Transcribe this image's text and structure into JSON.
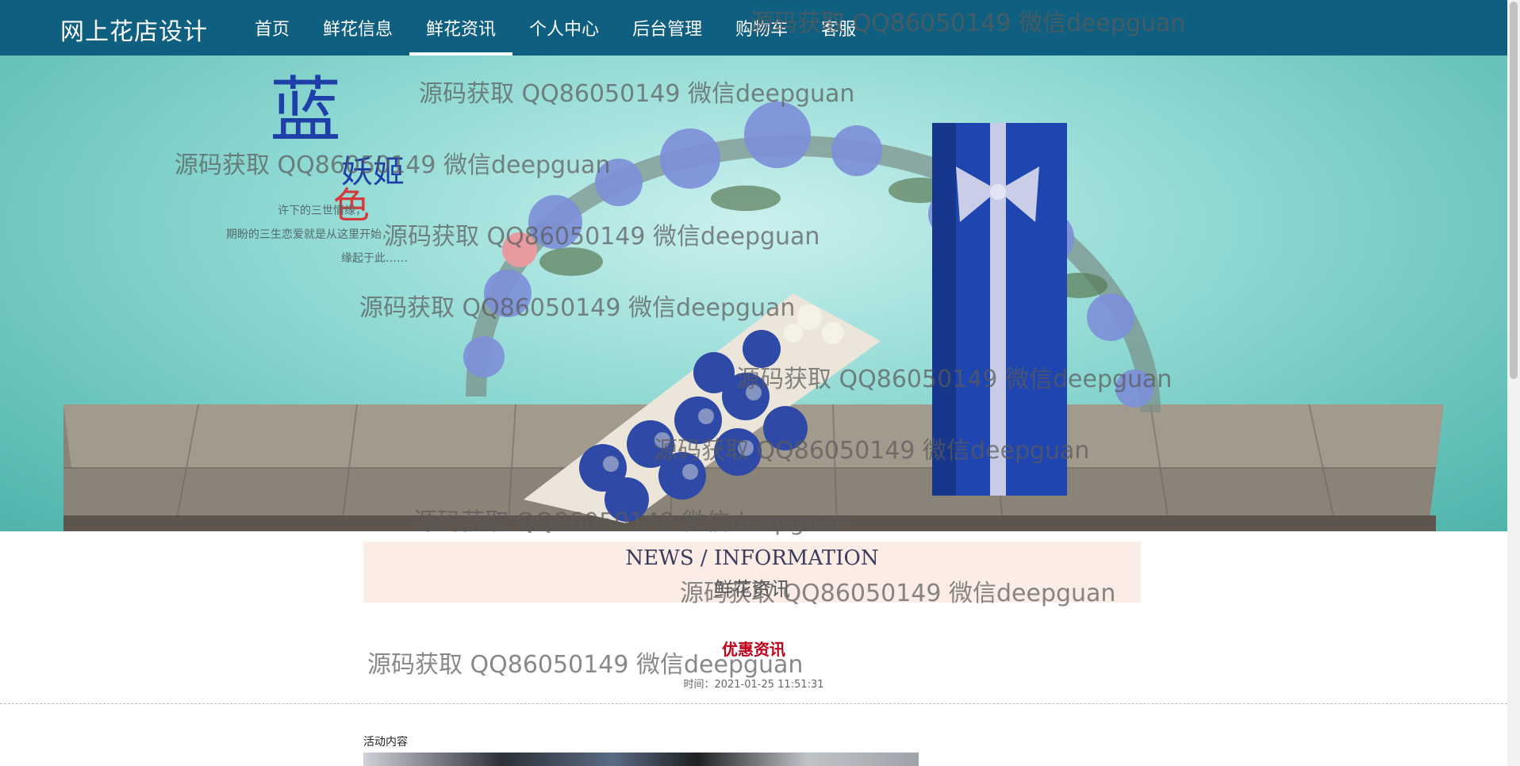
{
  "brand": "网上花店设计",
  "nav": {
    "items": [
      {
        "label": "首页"
      },
      {
        "label": "鲜花信息"
      },
      {
        "label": "鲜花资讯",
        "active": true
      },
      {
        "label": "个人中心"
      },
      {
        "label": "后台管理"
      },
      {
        "label": "购物车"
      },
      {
        "label": "客服"
      }
    ]
  },
  "banner": {
    "calligraphy_title": "蓝色妖姬",
    "poem_lines": [
      "许下的三世情缘，",
      "期盼的三生恋爱就是从这里开始，",
      "缘起于此……"
    ]
  },
  "section": {
    "title_en": "NEWS / INFORMATION",
    "title_zh": "鲜花资讯"
  },
  "article": {
    "title": "优惠资讯",
    "time": "时间：2021-01-25 11:51:31",
    "content_label": "活动内容"
  },
  "watermark": "源码获取 QQ86050149 微信deepguan",
  "colors": {
    "nav_bg": "#0f5f80",
    "section_bg": "#fbece6",
    "article_title": "#c0001a"
  }
}
